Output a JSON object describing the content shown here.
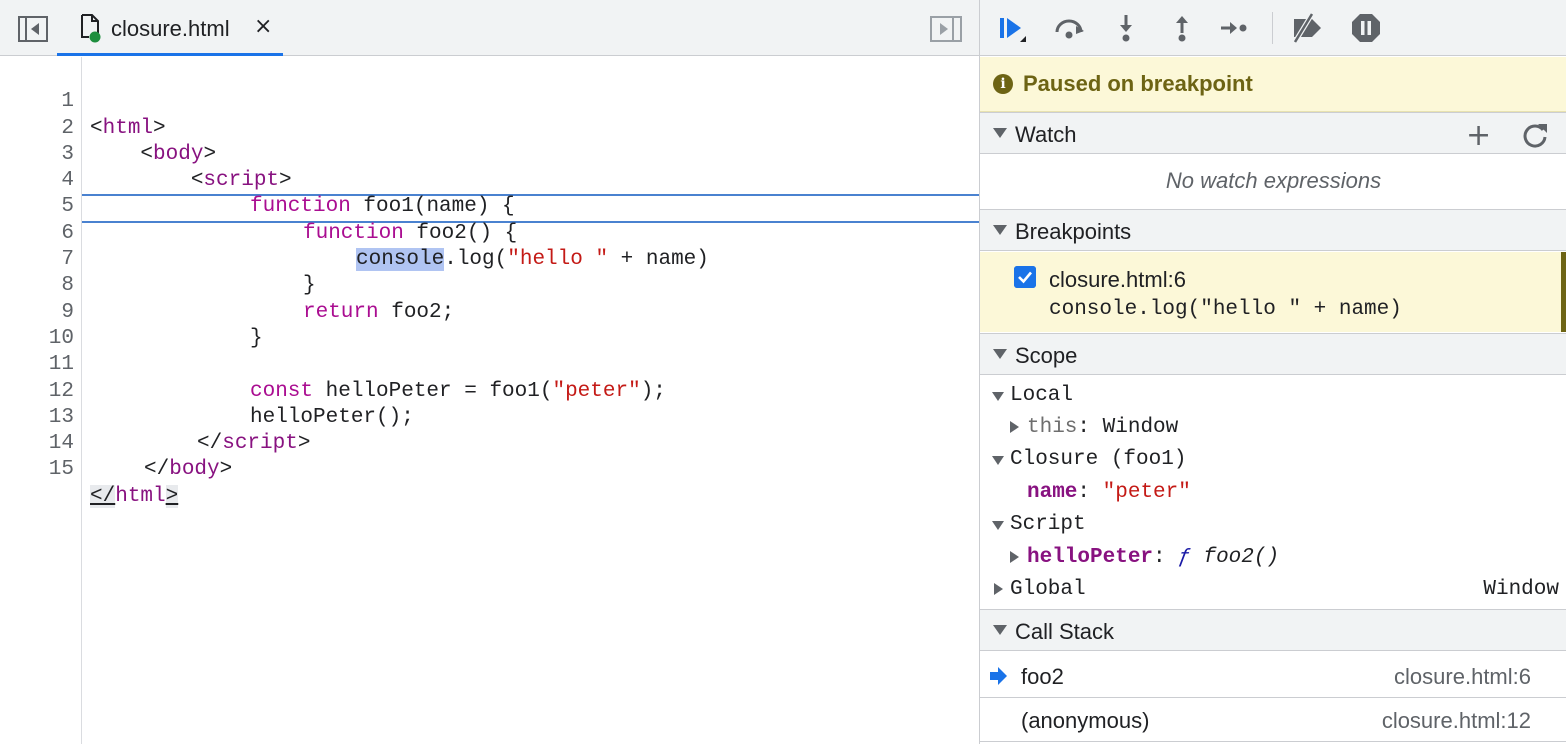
{
  "editor": {
    "tab_label": "closure.html",
    "tab_close": "×",
    "lines": [
      {
        "n": "1"
      },
      {
        "n": "2"
      },
      {
        "n": "3"
      },
      {
        "n": "4"
      },
      {
        "n": "5"
      },
      {
        "n": "6"
      },
      {
        "n": "7"
      },
      {
        "n": "8"
      },
      {
        "n": "9"
      },
      {
        "n": "10"
      },
      {
        "n": "11"
      },
      {
        "n": "12"
      },
      {
        "n": "13"
      },
      {
        "n": "14"
      },
      {
        "n": "15"
      }
    ],
    "code": {
      "l1_a": "<",
      "l1_b": "html",
      "l1_c": ">",
      "l2_a": "    <",
      "l2_b": "body",
      "l2_c": ">",
      "l3_a": "        <",
      "l3_b": "script",
      "l3_c": ">",
      "l4_kw": "function",
      "l4_rest": " foo1(name) {",
      "l5_kw": "function",
      "l5_rest": " foo2() {",
      "l6_hl": "console",
      "l6_mid": ".log(",
      "l6_str": "\"hello \"",
      "l6_end": " + name)",
      "l7": "}",
      "l8_kw": "return",
      "l8_rest": " foo2;",
      "l9": "}",
      "l11_kw": "const",
      "l11_mid": " helloPeter = foo1(",
      "l11_str": "\"peter\"",
      "l11_end": ");",
      "l12": "helloPeter();",
      "l13_a": "</",
      "l13_b": "script",
      "l13_c": ">",
      "l14_a": "</",
      "l14_b": "body",
      "l14_c": ">",
      "l15_a": "</",
      "l15_b": "html",
      "l15_c": ">"
    }
  },
  "debugger": {
    "status": "Paused on breakpoint",
    "status_icon": "i",
    "sections": {
      "watch": "Watch",
      "breakpoints": "Breakpoints",
      "scope": "Scope",
      "call_stack": "Call Stack"
    },
    "watch_add": "+",
    "watch_empty": "No watch expressions",
    "breakpoint": {
      "label": "closure.html:6",
      "code": "console.log(\"hello \" + name)",
      "checked": true
    },
    "scope": {
      "local": "Local",
      "this_key": "this",
      "this_sep": ": ",
      "this_val": "Window",
      "closure": "Closure (foo1)",
      "name_key": "name",
      "name_sep": ": ",
      "name_val": "\"peter\"",
      "script": "Script",
      "hp_key": "helloPeter",
      "hp_sep": ": ",
      "hp_f": "ƒ",
      "hp_val": " foo2()",
      "global": "Global",
      "global_val": "Window"
    },
    "call_stack": [
      {
        "fn": "foo2",
        "loc": "closure.html:6"
      },
      {
        "fn": "(anonymous)",
        "loc": "closure.html:12"
      }
    ]
  },
  "colors": {
    "accent": "#1a73e8",
    "paused_bg": "#fcf8d8",
    "paused_text": "#6d6414",
    "tag": "#881280",
    "keyword": "#aa0d91",
    "string": "#c41a16"
  },
  "icons": {
    "navigator_toggle": "navigator-toggle-icon",
    "file": "file-icon",
    "debugger_toggle": "debugger-toggle-icon",
    "resume": "resume-icon",
    "step_over": "step-over-icon",
    "step_into": "step-into-icon",
    "step_out": "step-out-icon",
    "step": "step-icon",
    "deactivate": "deactivate-breakpoints-icon",
    "pause_exceptions": "pause-on-exceptions-icon",
    "refresh": "refresh-icon",
    "current_frame": "current-frame-arrow-icon"
  }
}
